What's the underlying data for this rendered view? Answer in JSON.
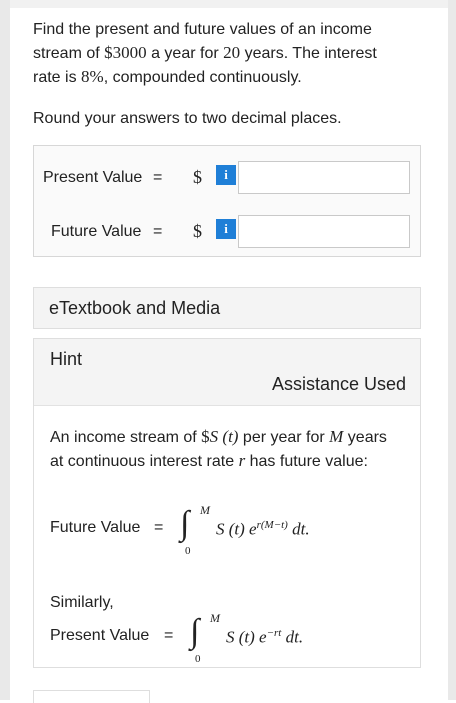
{
  "question": {
    "line1": "Find the present and future values of an income",
    "line2_pre": "stream of ",
    "amount": "$3000",
    "line2_post": " a year for ",
    "years": "20",
    "line2_end": " years. The interest",
    "line3_pre": "rate is ",
    "rate": "8%",
    "line3_post": ", compounded continuously."
  },
  "round_text": "Round your answers to two decimal places.",
  "answers": {
    "present_label": "Present Value",
    "future_label": "Future Value",
    "eq": "=",
    "dollar": "$",
    "info": "i",
    "present_value": "",
    "future_value": ""
  },
  "etextbook": "eTextbook and Media",
  "hint": {
    "title": "Hint",
    "assistance": "Assistance Used",
    "text_pre": "An income stream of ",
    "s_dollar": "$",
    "s_func": "S (t)",
    "text_mid": " per year for ",
    "M": "M",
    "text_mid2": " years at continuous interest rate ",
    "r": "r",
    "text_end": " has future value:",
    "future_label": "Future Value",
    "eq": "=",
    "future_integrand": "S (t) e",
    "future_exp": "r(M−t)",
    "dt": " dt.",
    "upper": "M",
    "lower": "0",
    "similarly": "Similarly,",
    "present_label": "Present Value",
    "present_integrand": "S (t) e",
    "present_exp": "−rt",
    "integral_sign": "∫"
  }
}
